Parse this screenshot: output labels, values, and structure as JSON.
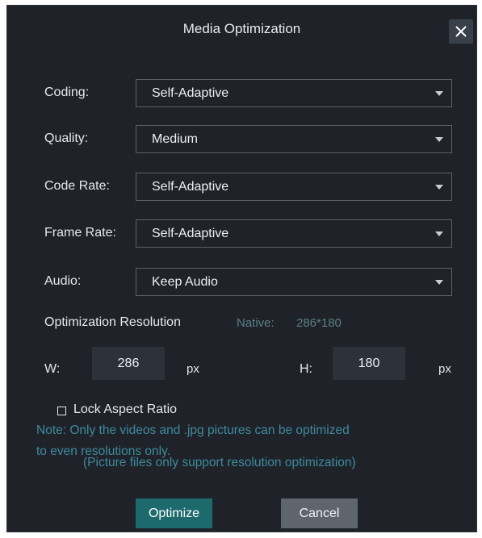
{
  "dialog": {
    "title": "Media Optimization"
  },
  "fields": [
    {
      "label": "Coding:",
      "value": "Self-Adaptive"
    },
    {
      "label": "Quality:",
      "value": "Medium"
    },
    {
      "label": "Code Rate:",
      "value": "Self-Adaptive"
    },
    {
      "label": "Frame Rate:",
      "value": "Self-Adaptive"
    },
    {
      "label": "Audio:",
      "value": "Keep Audio"
    }
  ],
  "resolution": {
    "heading": "Optimization Resolution",
    "native_label": "Native:",
    "native_value": "286*180",
    "width_label": "W:",
    "width_value": "286",
    "width_unit": "px",
    "height_label": "H:",
    "height_value": "180",
    "height_unit": "px"
  },
  "lock_aspect": {
    "label": "Lock Aspect Ratio",
    "checked": false
  },
  "note": {
    "line1": "Note: Only the videos and .jpg pictures can be optimized",
    "line2": "to even resolutions only.",
    "line3": "(Picture files only support resolution optimization)"
  },
  "buttons": {
    "optimize": "Optimize",
    "cancel": "Cancel"
  },
  "icons": {
    "close": "close-icon",
    "dropdown": "chevron-down-icon",
    "checkbox": "checkbox-icon"
  },
  "colors": {
    "dialog_bg": "#1f2329",
    "primary": "#1d6a6d",
    "note": "#3d8a9c",
    "native": "#5a7e86"
  }
}
